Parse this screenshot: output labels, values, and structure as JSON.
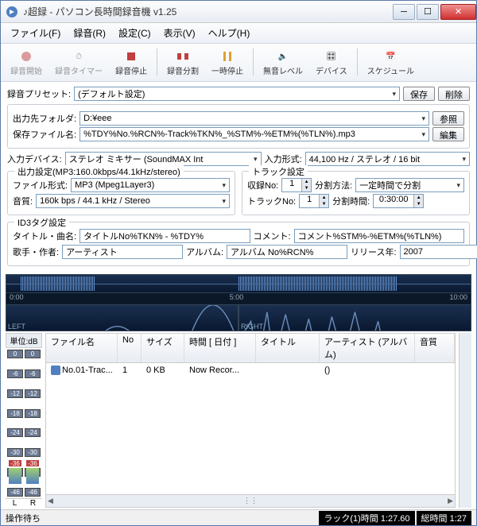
{
  "window": {
    "title": "♪超録 - パソコン長時間録音機 v1.25"
  },
  "menu": {
    "file": "ファイル(F)",
    "record": "録音(R)",
    "settings": "設定(C)",
    "view": "表示(V)",
    "help": "ヘルプ(H)"
  },
  "toolbar": {
    "rec_start": "録音開始",
    "rec_timer": "録音タイマー",
    "rec_stop": "録音停止",
    "rec_split": "録音分割",
    "pause": "一時停止",
    "level": "無音レベル",
    "device": "デバイス",
    "schedule": "スケジュール"
  },
  "preset": {
    "label": "録音プリセット:",
    "value": "(デフォルト設定)",
    "save": "保存",
    "delete": "削除"
  },
  "output": {
    "folder_label": "出力先フォルダ:",
    "folder": "D:¥eee",
    "browse": "参照",
    "pattern_label": "保存ファイル名:",
    "pattern": "%TDY%No.%RCN%-Track%TKN%_%STM%-%ETM%(%TLN%).mp3",
    "edit": "編集"
  },
  "input_device": {
    "label": "入力デバイス:",
    "value": "ステレオ ミキサー (SoundMAX Int"
  },
  "input_format": {
    "label": "入力形式:",
    "value": "44,100 Hz / ステレオ / 16 bit"
  },
  "out_settings": {
    "title": "出力設定(MP3:160.0kbps/44.1kHz/stereo)",
    "format_label": "ファイル形式:",
    "format": "MP3 (Mpeg1Layer3)",
    "quality_label": "音質:",
    "quality": "160k bps / 44.1 kHz / Stereo"
  },
  "track_settings": {
    "title": "トラック設定",
    "recno_label": "収録No:",
    "recno": "1",
    "split_method_label": "分割方法:",
    "split_method": "一定時間で分割",
    "trackno_label": "トラックNo:",
    "trackno": "1",
    "split_time_label": "分割時間:",
    "split_time": "0:30:00"
  },
  "id3": {
    "title": "ID3タグ設定",
    "title_label": "タイトル・曲名:",
    "title_value": "タイトルNo%TKN% - %TDY%",
    "comment_label": "コメント:",
    "comment_value": "コメント%STM%-%ETM%(%TLN%)",
    "artist_label": "歌手・作者:",
    "artist_value": "アーティスト",
    "album_label": "アルバム:",
    "album_value": "アルバム No%RCN%",
    "year_label": "リリース年:",
    "year_value": "2007"
  },
  "ruler": {
    "t0": "0:00",
    "t1": "5:00",
    "t2": "10:00"
  },
  "channels": {
    "left": "LEFT",
    "right": "RIGHT"
  },
  "meters": {
    "header": "単位:dB",
    "ticks": [
      "0",
      "-6",
      "-12",
      "-18",
      "-24",
      "-30",
      "-36",
      "-46"
    ],
    "peak_l": "-36",
    "peak_r": "-36",
    "L": "L",
    "R": "R"
  },
  "columns": {
    "file": "ファイル名",
    "no": "No",
    "size": "サイズ",
    "date": "時間 [ 日付 ]",
    "title": "タイトル",
    "artist": "アーティスト (アルバム)",
    "quality": "音質"
  },
  "row1": {
    "file": "No.01-Trac...",
    "no": "1",
    "size": "0 KB",
    "date": "Now Recor...",
    "title": "",
    "artist": "()",
    "quality": ""
  },
  "status": {
    "main": "操作待ち",
    "track": "ラック(1)時間 1:27.60",
    "total": "総時間 1:27"
  }
}
